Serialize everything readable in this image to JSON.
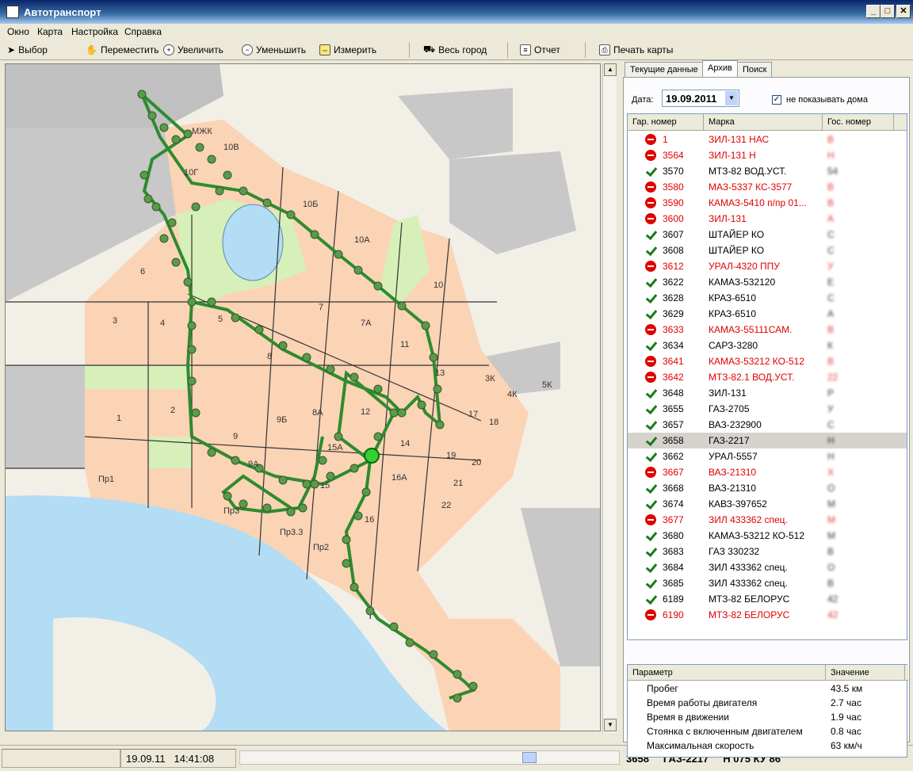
{
  "window": {
    "title": "Автотранспорт",
    "min": "_",
    "max": "□",
    "close": "✕"
  },
  "menu": [
    "Окно",
    "Карта",
    "Настройка",
    "Справка"
  ],
  "toolbar": {
    "select": "Выбор",
    "pan": "Переместить",
    "zoom_in": "Увеличить",
    "zoom_out": "Уменьшить",
    "measure": "Измерить",
    "whole_city": "Весь город",
    "report": "Отчет",
    "print_map": "Печать карты"
  },
  "tabs": [
    "Текущие данные",
    "Архив",
    "Поиск"
  ],
  "filters": {
    "date_label": "Дата:",
    "date_value": "19.09.2011",
    "hide_houses_label": "не показывать дома",
    "hide_houses_checked": "✓"
  },
  "vehicles": {
    "columns": [
      "Гар. номер",
      "Марка",
      "Гос. номер"
    ],
    "rows": [
      {
        "g": "1",
        "m": "ЗИЛ-131 НАС",
        "p": "В",
        "s": "stop"
      },
      {
        "g": "3564",
        "m": "ЗИЛ-131 Н",
        "p": "Н",
        "s": "stop"
      },
      {
        "g": "3570",
        "m": "МТЗ-82 ВОД.УСТ.",
        "p": "54",
        "s": "ok"
      },
      {
        "g": "3580",
        "m": "МАЗ-5337 КС-3577",
        "p": "В",
        "s": "stop"
      },
      {
        "g": "3590",
        "m": "КАМАЗ-5410 п/пр 01...",
        "p": "В",
        "s": "stop"
      },
      {
        "g": "3600",
        "m": "ЗИЛ-131",
        "p": "А",
        "s": "stop"
      },
      {
        "g": "3607",
        "m": "ШТАЙЕР КО",
        "p": "С",
        "s": "ok"
      },
      {
        "g": "3608",
        "m": "ШТАЙЕР КО",
        "p": "С",
        "s": "ok"
      },
      {
        "g": "3612",
        "m": "УРАЛ-4320 ППУ",
        "p": "У",
        "s": "stop"
      },
      {
        "g": "3622",
        "m": "КАМАЗ-532120",
        "p": "Е",
        "s": "ok"
      },
      {
        "g": "3628",
        "m": "КРАЗ-6510",
        "p": "С",
        "s": "ok"
      },
      {
        "g": "3629",
        "m": "КРАЗ-6510",
        "p": "А",
        "s": "ok"
      },
      {
        "g": "3633",
        "m": "КАМАЗ-55111САМ.",
        "p": "В",
        "s": "stop"
      },
      {
        "g": "3634",
        "m": "САРЗ-3280",
        "p": "К",
        "s": "ok"
      },
      {
        "g": "3641",
        "m": "КАМАЗ-53212 КО-512",
        "p": "В",
        "s": "stop"
      },
      {
        "g": "3642",
        "m": "МТЗ-82.1 ВОД.УСТ.",
        "p": "22",
        "s": "stop"
      },
      {
        "g": "3648",
        "m": "ЗИЛ-131",
        "p": "Р",
        "s": "ok"
      },
      {
        "g": "3655",
        "m": "ГАЗ-2705",
        "p": "У",
        "s": "ok"
      },
      {
        "g": "3657",
        "m": "ВАЗ-232900",
        "p": "С",
        "s": "ok"
      },
      {
        "g": "3658",
        "m": "ГАЗ-2217",
        "p": "Н",
        "s": "ok",
        "selected": true
      },
      {
        "g": "3662",
        "m": "УРАЛ-5557",
        "p": "Н",
        "s": "ok"
      },
      {
        "g": "3667",
        "m": "ВАЗ-21310",
        "p": "Х",
        "s": "stop"
      },
      {
        "g": "3668",
        "m": "ВАЗ-21310",
        "p": "О",
        "s": "ok"
      },
      {
        "g": "3674",
        "m": "КАВЗ-397652",
        "p": "М",
        "s": "ok"
      },
      {
        "g": "3677",
        "m": "ЗИЛ 433362 спец.",
        "p": "М",
        "s": "stop"
      },
      {
        "g": "3680",
        "m": "КАМАЗ-53212 КО-512",
        "p": "М",
        "s": "ok"
      },
      {
        "g": "3683",
        "m": "ГАЗ 330232",
        "p": "В",
        "s": "ok"
      },
      {
        "g": "3684",
        "m": "ЗИЛ 433362 спец.",
        "p": "О",
        "s": "ok"
      },
      {
        "g": "3685",
        "m": "ЗИЛ 433362 спец.",
        "p": "В",
        "s": "ok"
      },
      {
        "g": "6189",
        "m": "МТЗ-82 БЕЛОРУС",
        "p": "42",
        "s": "ok"
      },
      {
        "g": "6190",
        "m": "МТЗ-82 БЕЛОРУС",
        "p": "42",
        "s": "stop"
      }
    ]
  },
  "params": {
    "columns": [
      "Параметр",
      "Значение"
    ],
    "rows": [
      {
        "n": "Пробег",
        "v": "43.5 км"
      },
      {
        "n": "Время работы двигателя",
        "v": "2.7 час"
      },
      {
        "n": "Время в движении",
        "v": "1.9 час"
      },
      {
        "n": "Стоянка с включенным двигателем",
        "v": "0.8 час"
      },
      {
        "n": "Максимальная скорость",
        "v": "63 км/ч"
      }
    ]
  },
  "status": {
    "date": "19.09.11",
    "time": "14:41:08",
    "garage": "3658",
    "model": "ГАЗ-2217",
    "plate": "Н 075 КУ 86"
  },
  "map": {
    "labels": [
      "МЖК",
      "10В",
      "10Г",
      "10Б",
      "10А",
      "10",
      "6",
      "7",
      "7А",
      "3",
      "4",
      "5",
      "8",
      "11",
      "13",
      "3К",
      "4К",
      "5К",
      "2",
      "9Б",
      "8А",
      "12",
      "17",
      "18",
      "1",
      "9",
      "15А",
      "14",
      "19",
      "20",
      "9А",
      "16А",
      "21",
      "15",
      "22",
      "Пр1",
      "16",
      "Пр3",
      "Пр3.3",
      "Пр2"
    ],
    "colors": {
      "block": "#fbd3b5",
      "park": "#d7efb8",
      "water": "#b3dcf5",
      "industrial": "#c0c0c0",
      "track": "#5a9a4a",
      "bg": "#f2efe6"
    }
  }
}
